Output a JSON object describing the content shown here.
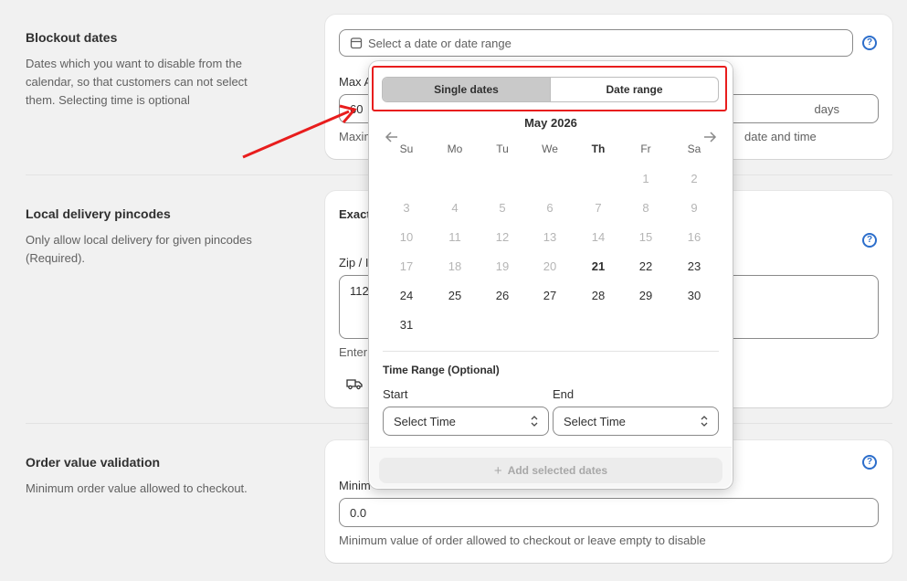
{
  "sections": {
    "blockout": {
      "title": "Blockout dates",
      "desc_lines": [
        "Dates which you want to disable from the",
        "calendar, so that customers can not select",
        "them. Selecting time is optional"
      ],
      "date_placeholder": "Select a date or date range",
      "max_label": "Max A",
      "max_value": "60",
      "max_suffix": "days",
      "max_help_left": "Maxim",
      "max_help_right": "date and time"
    },
    "pincodes": {
      "title": "Local delivery pincodes",
      "desc_lines": [
        "Only allow local delivery for given pincodes",
        "(Required)."
      ],
      "exact_label": "Exact",
      "zip_label": "Zip / I",
      "zip_value": "112",
      "enter_help": "Enter"
    },
    "order_value": {
      "title": "Order value validation",
      "desc": "Minimum order value allowed to checkout.",
      "min_label": "Minim",
      "min_value": "0.0",
      "min_help": "Minimum value of order allowed to checkout or leave empty to disable"
    }
  },
  "datepicker": {
    "tabs": [
      "Single dates",
      "Date range"
    ],
    "active_tab": "Single dates",
    "month": "May 2026",
    "weekdays": [
      "Su",
      "Mo",
      "Tu",
      "We",
      "Th",
      "Fr",
      "Sa"
    ],
    "highlight_weekday": "Th",
    "first_weekday_index": 5,
    "days_in_month": 31,
    "today": 21,
    "first_enabled_day": 21,
    "time_range_label": "Time Range (Optional)",
    "start_label": "Start",
    "end_label": "End",
    "start_placeholder": "Select Time",
    "end_placeholder": "Select Time",
    "add_button": "Add selected dates"
  },
  "colors": {
    "annotation_red": "#e81d1d",
    "help_blue": "#2c6ecb"
  }
}
